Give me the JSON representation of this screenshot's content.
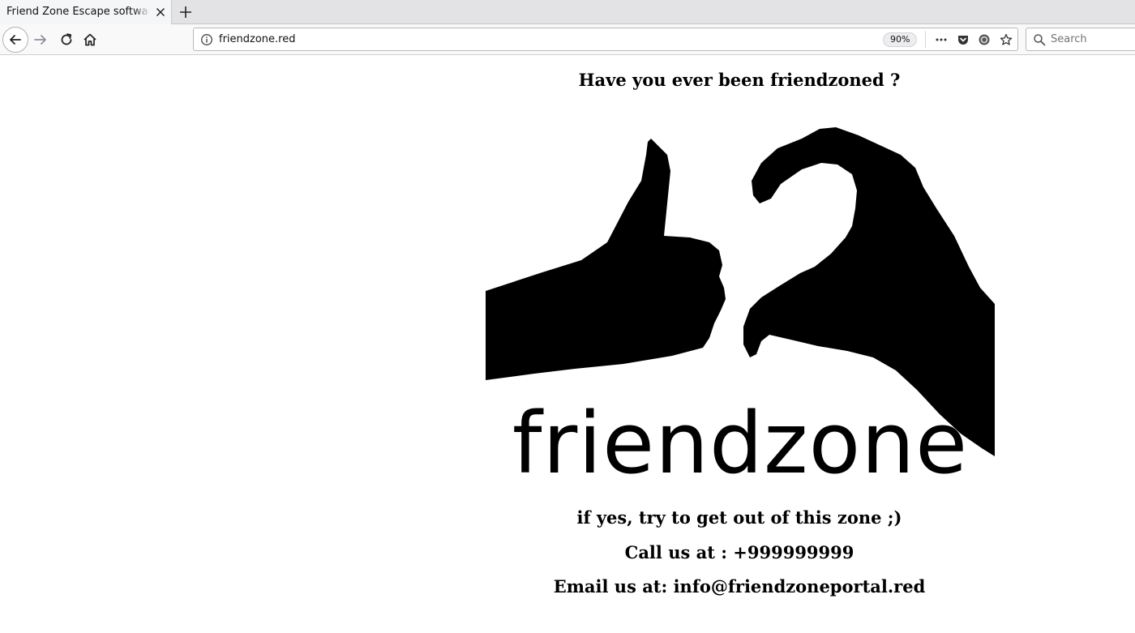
{
  "browser": {
    "tab_title": "Friend Zone Escape software",
    "url": "friendzone.red",
    "zoom": "90%",
    "search_placeholder": "Search"
  },
  "page": {
    "heading": "Have you ever been friendzoned ?",
    "logo_text": "friendzone",
    "tagline": "if yes, try to get out of this zone ;)",
    "call": "Call us at : +999999999",
    "email": "Email us at: info@friendzoneportal.red"
  }
}
